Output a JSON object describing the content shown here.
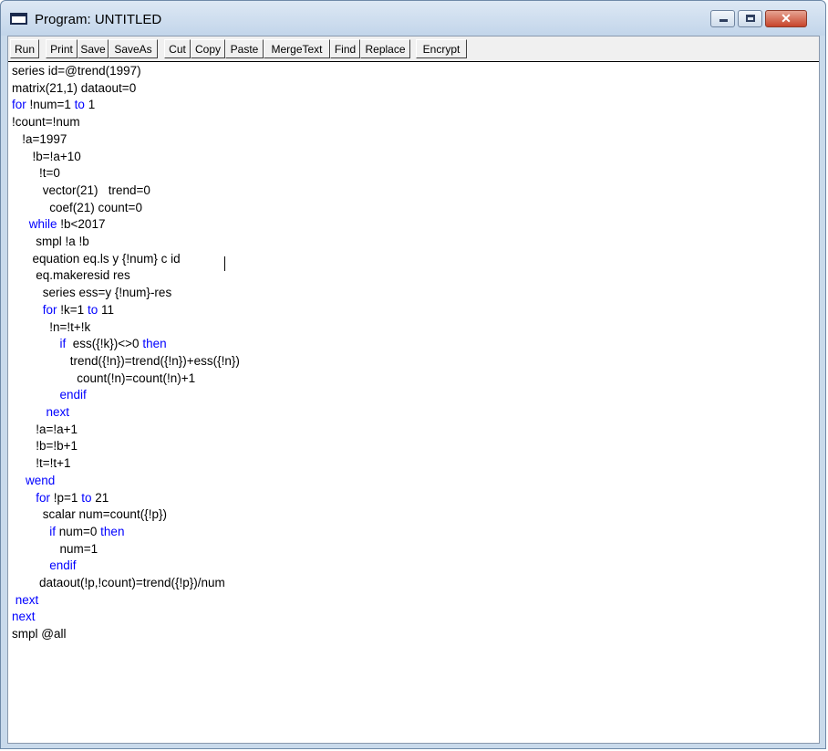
{
  "window": {
    "title": "Program: UNTITLED"
  },
  "toolbar": {
    "buttons": [
      {
        "label": "Run"
      },
      {
        "label": "Print"
      },
      {
        "label": "Save"
      },
      {
        "label": "SaveAs"
      },
      {
        "label": "Cut"
      },
      {
        "label": "Copy"
      },
      {
        "label": "Paste"
      },
      {
        "label": "MergeText"
      },
      {
        "label": "Find"
      },
      {
        "label": "Replace"
      },
      {
        "label": "Encrypt"
      }
    ]
  },
  "colors": {
    "keyword": "#0000ff",
    "text": "#000000",
    "titlebar": "#c9daeb",
    "close_button": "#c7442a"
  },
  "icons": {
    "title": "program-window-icon",
    "minimize": "minimize-icon",
    "maximize": "maximize-icon",
    "close": "close-icon"
  },
  "editor": {
    "lines": [
      "series id=@trend(1997)",
      "matrix(21,1) dataout=0",
      "for !num=1 to 1",
      "!count=!num",
      "   !a=1997",
      "      !b=!a+10",
      "        !t=0",
      "         vector(21)   trend=0",
      "           coef(21) count=0",
      "     while !b<2017",
      "       smpl !a !b",
      "      equation eq.ls y {!num} c id",
      "       eq.makeresid res",
      "         series ess=y {!num}-res",
      "         for !k=1 to 11",
      "           !n=!t+!k",
      "              if  ess({!k})<>0 then",
      "                 trend({!n})=trend({!n})+ess({!n})",
      "                   count(!n)=count(!n)+1",
      "              endif",
      "          next",
      "       !a=!a+1",
      "       !b=!b+1",
      "       !t=!t+1",
      "    wend",
      "       for !p=1 to 21",
      "         scalar num=count({!p})",
      "           if num=0 then",
      "              num=1",
      "           endif",
      "        dataout(!p,!count)=trend({!p})/num",
      " next",
      "next",
      "smpl @all"
    ]
  }
}
